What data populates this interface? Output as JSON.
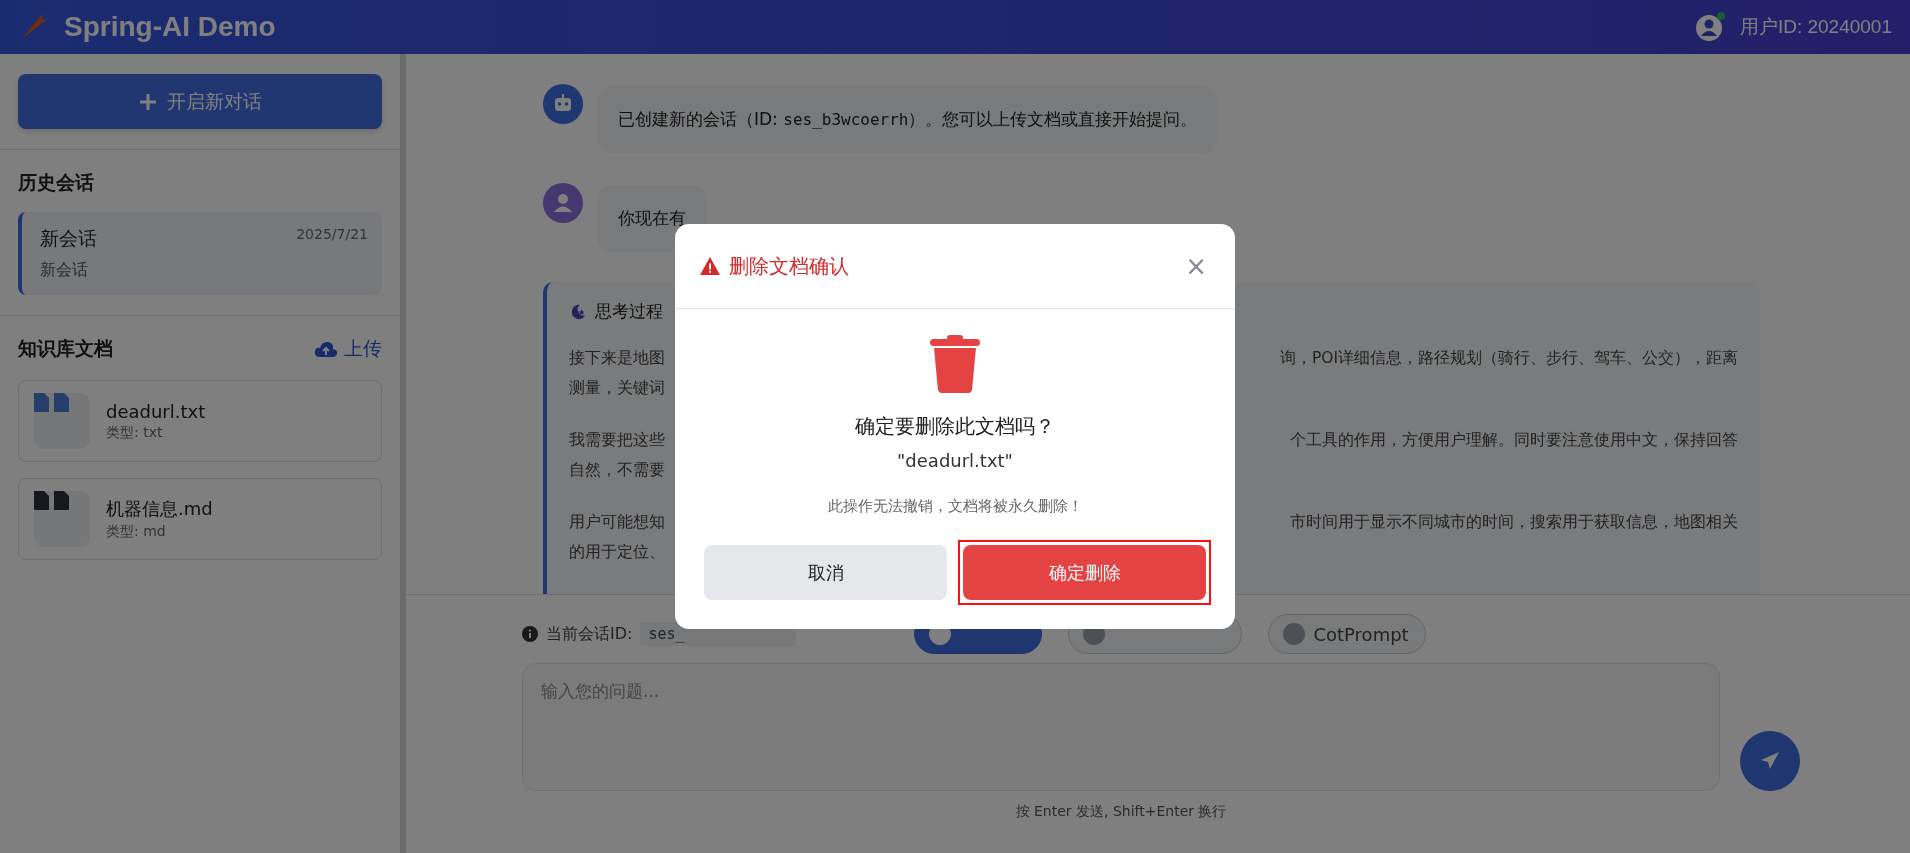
{
  "header": {
    "title": "Spring-AI Demo",
    "user_id": "用户ID: 20240001",
    "online": true
  },
  "sidebar": {
    "new_chat_button": "开启新对话",
    "history_title": "历史会话",
    "sessions": [
      {
        "title": "新会话",
        "date": "2025/7/21",
        "preview": "新会话",
        "selected": true
      }
    ],
    "docs_title": "知识库文档",
    "upload_button": "上传",
    "documents": [
      {
        "name": "deadurl.txt",
        "type": "类型: txt",
        "kind": "txt"
      },
      {
        "name": "机器信息.md",
        "type": "类型: md",
        "kind": "md"
      }
    ]
  },
  "messages": [
    {
      "kind": "assistant",
      "parts": [
        {
          "text": "已创建新的会话（ID: ",
          "code": false
        },
        {
          "text": "ses_b3wcoerrh",
          "code": true
        },
        {
          "text": "）。您可以上传文档或直接开始提问。",
          "code": false
        }
      ]
    },
    {
      "kind": "user",
      "parts": [
        {
          "text": "你现在有",
          "code": false
        }
      ]
    }
  ],
  "thinking": {
    "title": "思考过程",
    "paragraphs": [
      [
        {
          "left": "接下来是地图",
          "right": "询，POI详细信息，路径规划（骑行、步行、驾车、公交），距离"
        },
        {
          "left": "测量，关键词"
        }
      ],
      [
        {
          "left": "我需要把这些",
          "right": "个工具的作用，方便用户理解。同时要注意使用中文，保持回答"
        },
        {
          "left": "自然，不需要"
        }
      ],
      [
        {
          "left": "用户可能想知",
          "right": "市时间用于显示不同城市的时间，搜索用于获取信息，地图相关"
        },
        {
          "left": "的用于定位、"
        }
      ]
    ]
  },
  "input_bar": {
    "session_label": "当前会话ID:",
    "session_id": "ses_",
    "toggles": [
      {
        "on": true
      },
      {
        "on": false
      },
      {
        "label": "CotPrompt",
        "on": false
      }
    ],
    "placeholder": "输入您的问题...",
    "hint": "按 Enter 发送, Shift+Enter 换行"
  },
  "dialog": {
    "title": "删除文档确认",
    "close": "×",
    "question": "确定要删除此文档吗？",
    "filename": "\"deadurl.txt\"",
    "warning": "此操作无法撤销，文档将被永久删除！",
    "buttons": [
      {
        "label": "取消",
        "kind": "cancel",
        "highlighted": false
      },
      {
        "label": "确定删除",
        "kind": "danger",
        "highlighted": true
      }
    ]
  }
}
